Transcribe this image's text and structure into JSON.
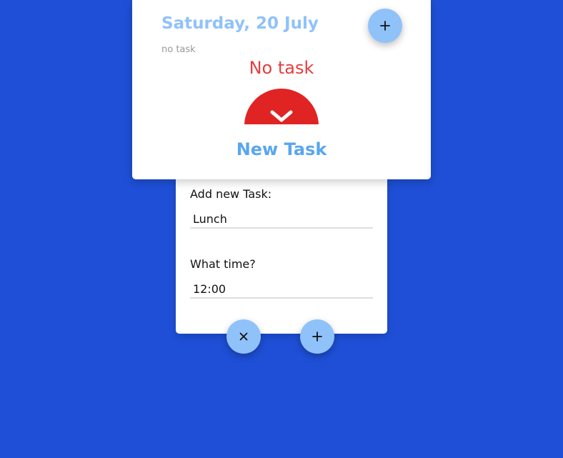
{
  "header": {
    "date": "Saturday, 20 July",
    "task_count_text": "no task",
    "empty_message": "No task",
    "new_task_label": "New Task"
  },
  "form": {
    "task_label": "Add new Task:",
    "task_value": "Lunch",
    "time_label": "What time?",
    "time_value": "12:00"
  },
  "icons": {
    "add": "plus-icon",
    "cancel": "close-icon",
    "confirm": "plus-icon",
    "toggle": "chevron-down-icon"
  },
  "colors": {
    "background": "#1e4fd6",
    "accent_light": "#90c2fa",
    "accent": "#5aa6ef",
    "danger": "#e02424",
    "danger_text": "#e53e3e"
  }
}
